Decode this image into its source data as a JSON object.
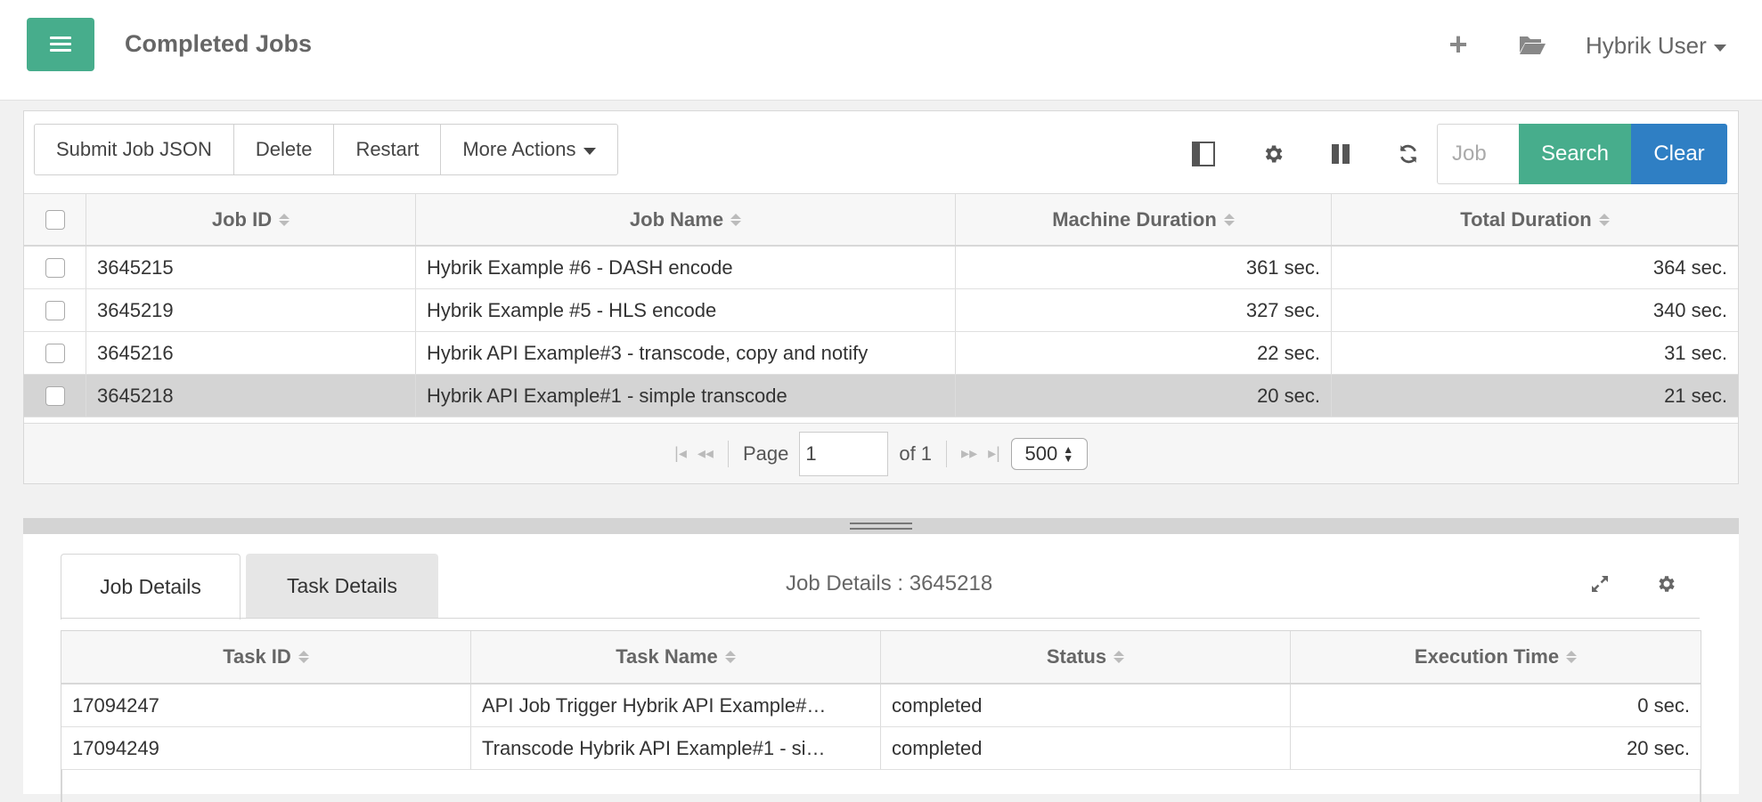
{
  "header": {
    "title": "Completed Jobs",
    "user": "Hybrik User"
  },
  "toolbar": {
    "submit_label": "Submit Job JSON",
    "delete_label": "Delete",
    "restart_label": "Restart",
    "more_label": "More Actions",
    "search_placeholder": "Job",
    "search_label": "Search",
    "clear_label": "Clear"
  },
  "jobs_table": {
    "columns": [
      "Job ID",
      "Job Name",
      "Machine Duration",
      "Total Duration"
    ],
    "rows": [
      {
        "id": "3645215",
        "name": "Hybrik Example #6 - DASH encode",
        "machine": "361 sec.",
        "total": "364 sec."
      },
      {
        "id": "3645219",
        "name": "Hybrik Example #5 - HLS encode",
        "machine": "327 sec.",
        "total": "340 sec."
      },
      {
        "id": "3645216",
        "name": "Hybrik API Example#3 - transcode, copy and notify",
        "machine": "22 sec.",
        "total": "31 sec."
      },
      {
        "id": "3645218",
        "name": "Hybrik API Example#1 - simple transcode",
        "machine": "20 sec.",
        "total": "21 sec."
      }
    ],
    "selected_index": 3
  },
  "pager": {
    "page_label": "Page",
    "page_value": "1",
    "of_label": "of 1",
    "page_size": "500"
  },
  "details": {
    "tab_job": "Job Details",
    "tab_task": "Task Details",
    "title": "Job Details : 3645218",
    "columns": [
      "Task ID",
      "Task Name",
      "Status",
      "Execution Time"
    ],
    "rows": [
      {
        "id": "17094247",
        "name": "API Job Trigger Hybrik API Example#…",
        "status": "completed",
        "exec": "0 sec."
      },
      {
        "id": "17094249",
        "name": "Transcode Hybrik API Example#1 - si…",
        "status": "completed",
        "exec": "20 sec."
      }
    ]
  },
  "icons": {
    "menu": "menu-icon",
    "add": "plus-icon",
    "folder": "folder-open-icon",
    "layout": "sidebar-toggle-icon",
    "settings": "gear-icon",
    "pause": "pause-icon",
    "refresh": "refresh-icon",
    "expand": "expand-icon"
  },
  "colors": {
    "accent_green": "#47ad8c",
    "accent_blue": "#2f7fc4",
    "selected_row": "#d4d4d4"
  }
}
